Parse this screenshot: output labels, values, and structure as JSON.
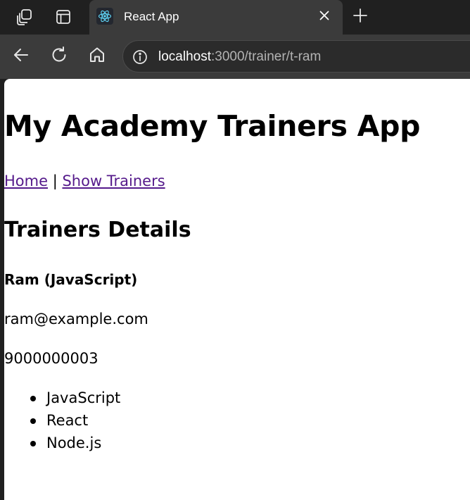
{
  "browser": {
    "tab": {
      "title": "React App",
      "favicon": "react-logo-icon"
    },
    "icons": {
      "workspaces": "workspaces-icon",
      "tab_actions": "tab-actions-icon",
      "close": "close-icon",
      "new_tab": "plus-icon",
      "back": "back-arrow-icon",
      "reload": "reload-icon",
      "home": "home-icon",
      "site_info": "info-icon"
    },
    "address": {
      "host": "localhost",
      "rest": ":3000/trainer/t-ram"
    }
  },
  "page": {
    "title": "My Academy Trainers App",
    "nav": {
      "home_label": "Home",
      "separator": " | ",
      "trainers_label": "Show Trainers"
    },
    "section_title": "Trainers Details",
    "trainer": {
      "name": "Ram (JavaScript)",
      "email": "ram@example.com",
      "phone": "9000000003",
      "skills": [
        "JavaScript",
        "React",
        "Node.js"
      ]
    }
  },
  "colors": {
    "chrome_dark": "#202020",
    "chrome_toolbar": "#3b3b3b",
    "visited_link": "#551a8b",
    "react_accent": "#61dafb"
  }
}
